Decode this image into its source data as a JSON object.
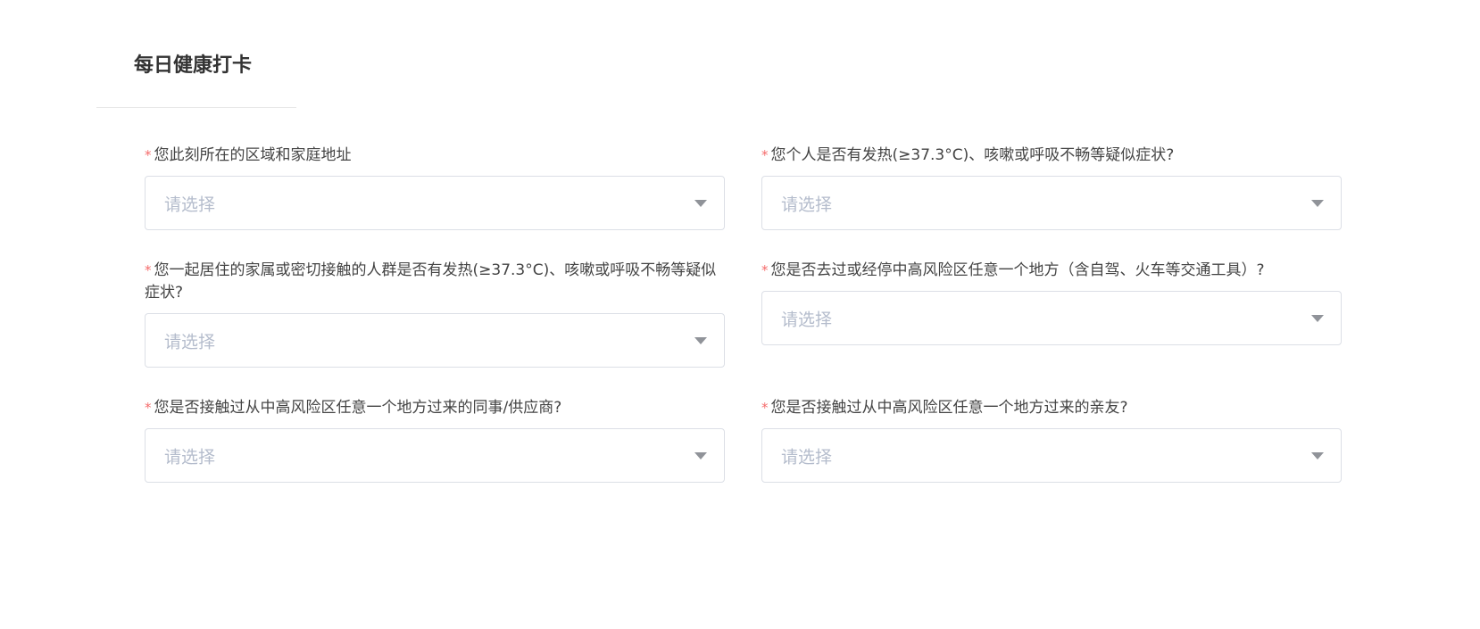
{
  "page": {
    "title": "每日健康打卡"
  },
  "form": {
    "fields": [
      {
        "label": "您此刻所在的区域和家庭地址",
        "required_mark": "*",
        "placeholder": "请选择"
      },
      {
        "label": "您个人是否有发热(≥37.3°C)、咳嗽或呼吸不畅等疑似症状?",
        "required_mark": "*",
        "placeholder": "请选择"
      },
      {
        "label": "您一起居住的家属或密切接触的人群是否有发热(≥37.3°C)、咳嗽或呼吸不畅等疑似症状?",
        "required_mark": "*",
        "placeholder": "请选择"
      },
      {
        "label": "您是否去过或经停中高风险区任意一个地方（含自驾、火车等交通工具）?",
        "required_mark": "*",
        "placeholder": "请选择"
      },
      {
        "label": "您是否接触过从中高风险区任意一个地方过来的同事/供应商?",
        "required_mark": "*",
        "placeholder": "请选择"
      },
      {
        "label": "您是否接触过从中高风险区任意一个地方过来的亲友?",
        "required_mark": "*",
        "placeholder": "请选择"
      }
    ]
  },
  "colors": {
    "required": "#f56c6c",
    "placeholder": "#b4bccc",
    "border": "#dcdfe6"
  },
  "icons": {
    "select_arrow": "chevron-down-icon"
  }
}
